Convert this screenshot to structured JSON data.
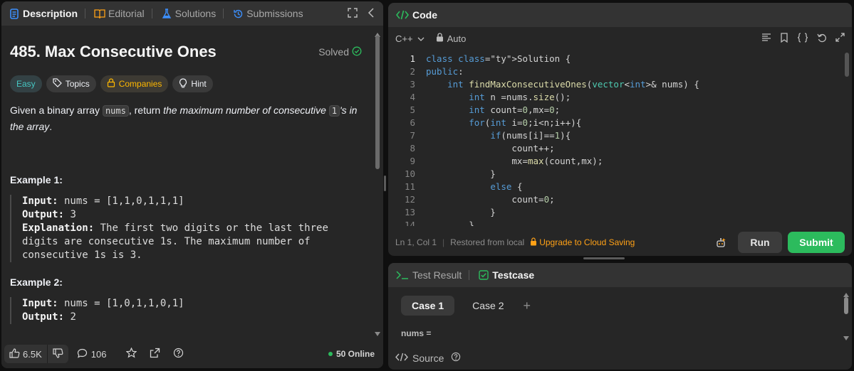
{
  "left_tabs": [
    {
      "label": "Description"
    },
    {
      "label": "Editorial"
    },
    {
      "label": "Solutions"
    },
    {
      "label": "Submissions"
    }
  ],
  "problem": {
    "title": "485. Max Consecutive Ones",
    "solved_label": "Solved",
    "tags": {
      "difficulty": "Easy",
      "topics": "Topics",
      "companies": "Companies",
      "hint": "Hint"
    },
    "statement": {
      "p1": "Given a binary array ",
      "code1": "nums",
      "p2": ", return ",
      "i1": "the maximum number of consecutive ",
      "code2": "1",
      "i2": "'s in the array",
      "p3": "."
    },
    "examples": [
      {
        "title": "Example 1:",
        "input_label": "Input:",
        "input": " nums = [1,1,0,1,1,1]",
        "output_label": "Output:",
        "output": " 3",
        "explanation_label": "Explanation:",
        "explanation": " The first two digits or the last three digits are consecutive 1s. The maximum number of consecutive 1s is 3."
      },
      {
        "title": "Example 2:",
        "input_label": "Input:",
        "input": " nums = [1,0,1,1,0,1]",
        "output_label": "Output:",
        "output": " 2"
      }
    ]
  },
  "footer": {
    "likes": "6.5K",
    "comments": "106",
    "online": "50 Online"
  },
  "code_panel": {
    "title": "Code",
    "language": "C++",
    "mode": "Auto",
    "status": {
      "position": "Ln 1, Col 1",
      "restored": "Restored from local",
      "upgrade": "Upgrade to Cloud Saving"
    },
    "run_label": "Run",
    "submit_label": "Submit",
    "lines": [
      "class Solution {",
      "public:",
      "    int findMaxConsecutiveOnes(vector<int>& nums) {",
      "        int n =nums.size();",
      "        int count=0,mx=0;",
      "        for(int i=0;i<n;i++){",
      "            if(nums[i]==1){",
      "                count++;",
      "                mx=max(count,mx);",
      "            }",
      "            else {",
      "                count=0;",
      "            }",
      "        }"
    ]
  },
  "test_panel": {
    "tabs": [
      "Test Result",
      "Testcase"
    ],
    "cases": [
      "Case 1",
      "Case 2"
    ],
    "param_label": "nums =",
    "source_label": "Source"
  },
  "colors": {
    "accent_green": "#2cbb5d",
    "easy": "#46c6c2",
    "companies": "#ffb800",
    "upgrade": "#ffa116"
  }
}
